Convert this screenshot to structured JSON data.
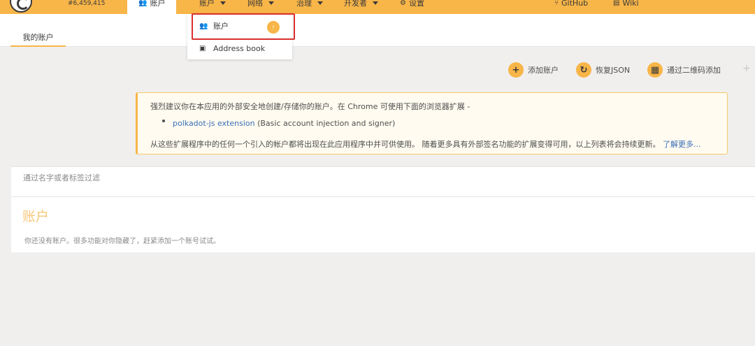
{
  "header": {
    "block_number": "#6,459,415",
    "tabs": [
      {
        "label": "账户",
        "icon": "users-icon",
        "active": true
      },
      {
        "label": "账户",
        "icon": "",
        "dropdown": true
      },
      {
        "label": "网络",
        "dropdown": true
      },
      {
        "label": "治理",
        "dropdown": true
      },
      {
        "label": "开发者",
        "dropdown": true
      },
      {
        "label": "设置",
        "icon": "gears-icon"
      },
      {
        "label": "GitHub",
        "icon": "code-branch-icon"
      },
      {
        "label": "Wiki",
        "icon": "book-icon"
      }
    ]
  },
  "dropdown": {
    "items": [
      {
        "label": "账户",
        "icon": "users-icon",
        "badge": "!"
      },
      {
        "label": "Address book",
        "icon": "address-card-icon"
      }
    ]
  },
  "subnav": {
    "tab_label": "我的账户"
  },
  "actions": {
    "add": "添加账户",
    "restore": "恢复JSON",
    "qr": "通过二维码添加",
    "more": "+"
  },
  "warning": {
    "line1": "强烈建议你在本应用的外部安全地创建/存储你的账户。在 Chrome 可使用下面的浏览器扩展 -",
    "ext_link": "polkadot-js extension",
    "ext_desc": " (Basic account injection and signer)",
    "line3_text": "从这些扩展程序中的任何一个引入的帐户都将出现在此应用程序中并可供使用。 随着更多具有外部签名功能的扩展变得可用，以上列表将会持续更新。",
    "learn_more": "了解更多..."
  },
  "filter": {
    "placeholder": "通过名字或者标签过滤"
  },
  "accounts": {
    "title": "账户",
    "empty": "你还没有账户。很多功能对你隐藏了，赶紧添加一个账号试试。"
  },
  "colors": {
    "accent": "#f8b548",
    "link": "#3a6eb8",
    "highlight": "#d9302c"
  }
}
